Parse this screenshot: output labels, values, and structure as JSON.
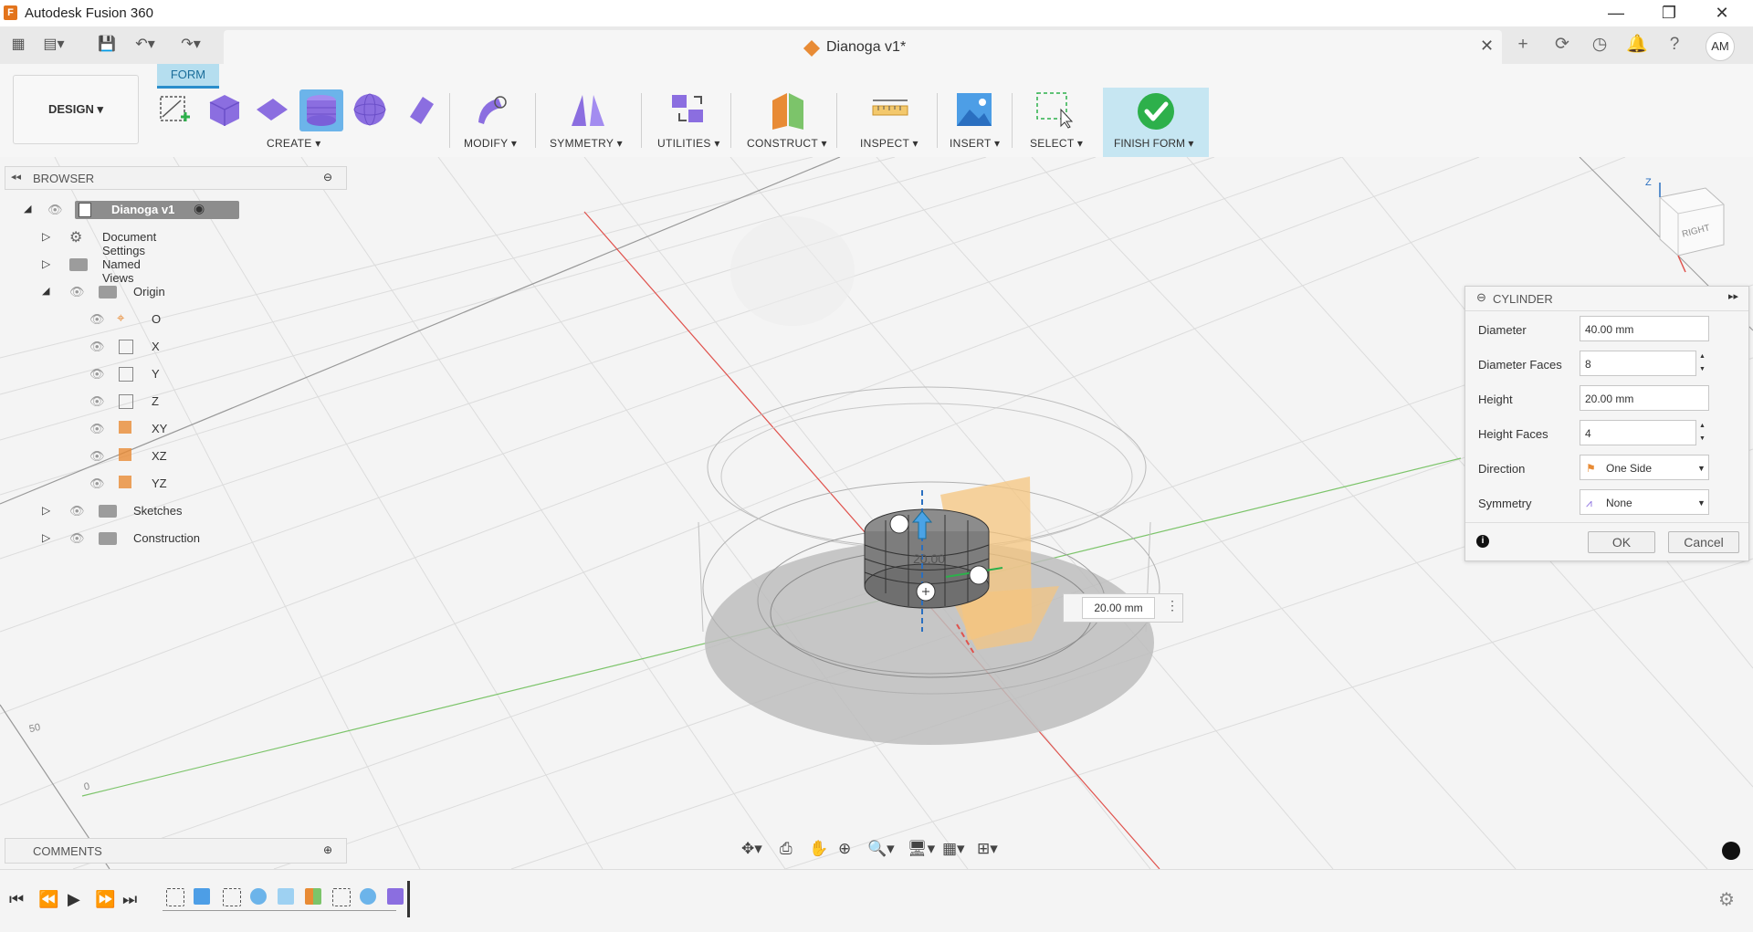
{
  "app": {
    "title": "Autodesk Fusion 360"
  },
  "document": {
    "title": "Dianoga v1*"
  },
  "user": {
    "initials": "AM"
  },
  "toolbar": {
    "workspace_label": "DESIGN ▾",
    "active_tab": "FORM",
    "groups": {
      "create": "CREATE ▾",
      "modify": "MODIFY ▾",
      "symmetry": "SYMMETRY ▾",
      "utilities": "UTILITIES ▾",
      "construct": "CONSTRUCT ▾",
      "inspect": "INSPECT ▾",
      "insert": "INSERT ▾",
      "select": "SELECT ▾",
      "finish": "FINISH FORM ▾"
    }
  },
  "browser": {
    "title": "BROWSER",
    "root": "Dianoga v1",
    "items": [
      {
        "label": "Document Settings"
      },
      {
        "label": "Named Views"
      },
      {
        "label": "Origin"
      },
      {
        "label": "O"
      },
      {
        "label": "X"
      },
      {
        "label": "Y"
      },
      {
        "label": "Z"
      },
      {
        "label": "XY"
      },
      {
        "label": "XZ"
      },
      {
        "label": "YZ"
      },
      {
        "label": "Sketches"
      },
      {
        "label": "Construction"
      }
    ]
  },
  "viewcube": {
    "face": "RIGHT",
    "axis": "Z"
  },
  "viewport": {
    "dimension_value": "20.00 mm",
    "model_label": "20.00",
    "grid_labels": [
      "50",
      "0"
    ]
  },
  "cylinder_panel": {
    "title": "CYLINDER",
    "fields": {
      "diameter_label": "Diameter",
      "diameter_value": "40.00 mm",
      "diameter_faces_label": "Diameter Faces",
      "diameter_faces_value": "8",
      "height_label": "Height",
      "height_value": "20.00 mm",
      "height_faces_label": "Height Faces",
      "height_faces_value": "4",
      "direction_label": "Direction",
      "direction_value": "One Side",
      "symmetry_label": "Symmetry",
      "symmetry_value": "None"
    },
    "ok_label": "OK",
    "cancel_label": "Cancel"
  },
  "comments": {
    "title": "COMMENTS"
  },
  "colors": {
    "accent": "#2a8ecb",
    "form_purple": "#8b6ee0",
    "finish_green": "#2db04b",
    "x_axis": "#e0524d",
    "y_axis": "#7cc46a"
  }
}
